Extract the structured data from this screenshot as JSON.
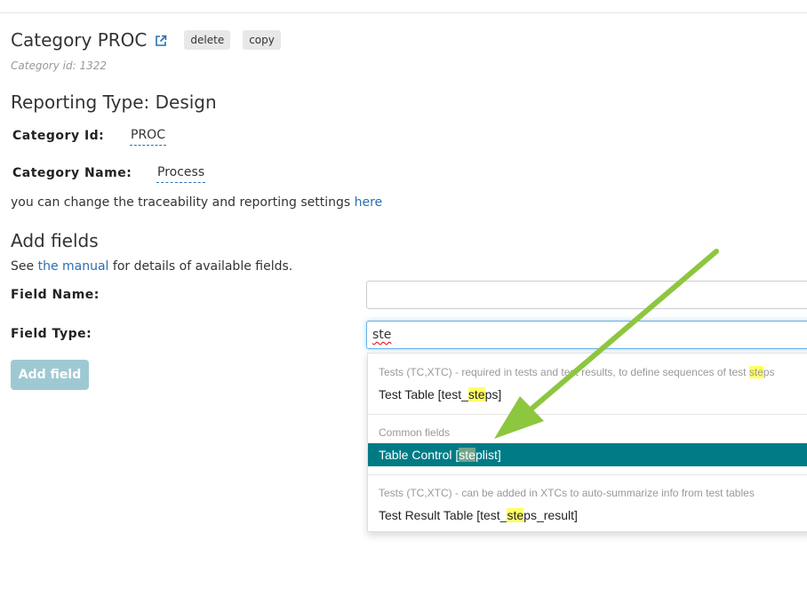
{
  "header": {
    "title": "Category PROC",
    "delete_label": "delete",
    "copy_label": "copy",
    "category_id_note": "Category id: 1322"
  },
  "reporting_type": "Reporting Type: Design",
  "fields": {
    "category_id_label": "Category Id:",
    "category_id_value": "PROC",
    "category_name_label": "Category Name:",
    "category_name_value": "Process"
  },
  "traceability": {
    "text": "you can change the traceability and reporting settings ",
    "link": "here"
  },
  "add_fields": {
    "heading": "Add fields",
    "see_prefix": "See ",
    "manual_link": "the manual",
    "see_suffix": " for details of available fields.",
    "field_name_label": "Field Name:",
    "field_name_value": "",
    "field_type_label": "Field Type:",
    "field_type_value": "ste",
    "add_button": "Add field"
  },
  "dropdown": {
    "groups": [
      {
        "header_a": "Tests (TC,XTC) - required in tests and test results, to define sequences of test ",
        "header_hl": "ste",
        "header_b": "ps",
        "option_a": "Test Table [test_",
        "option_hl": "ste",
        "option_b": "ps]"
      },
      {
        "header": "Common fields",
        "option_a": "Table Control [",
        "option_hl": "ste",
        "option_b": "plist]",
        "selected": true
      },
      {
        "header": "Tests (TC,XTC) - can be added in XTCs to auto-summarize info from test tables",
        "option_a": "Test Result Table [test_",
        "option_hl": "ste",
        "option_b": "ps_result]"
      }
    ]
  },
  "colors": {
    "link": "#2a6fb0",
    "selected_bg": "#007b85",
    "highlight": "#ffff66",
    "arrow": "#8dc63f",
    "add_button_bg": "#9fc9d2"
  },
  "icons": {
    "external_link": "external-link-icon",
    "annotation": "green-arrow"
  }
}
